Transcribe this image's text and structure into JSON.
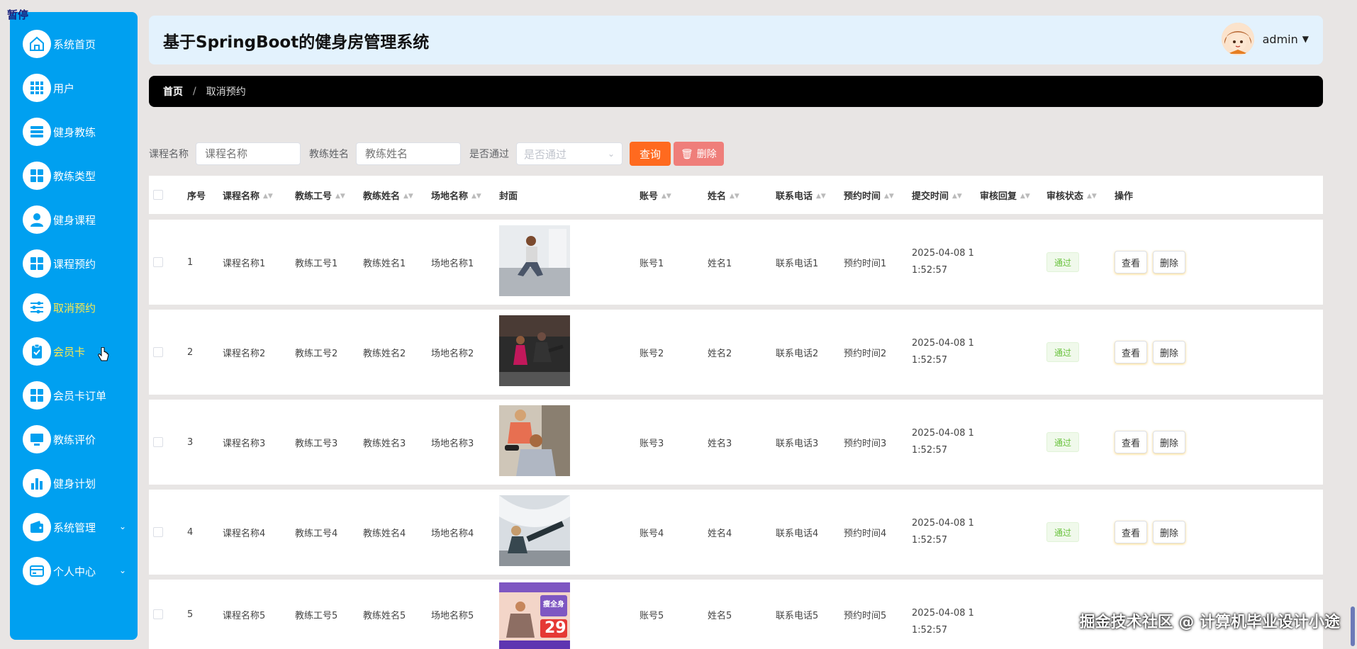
{
  "overlay": {
    "pause": "暂停",
    "watermark": "掘金技术社区 @ 计算机毕业设计小途"
  },
  "header": {
    "title": "基于SpringBoot的健身房管理系统",
    "user": "admin"
  },
  "breadcrumb": {
    "home": "首页",
    "current": "取消预约"
  },
  "sidebar": {
    "items": [
      {
        "label": "系统首页",
        "icon": "home-icon"
      },
      {
        "label": "用户",
        "icon": "grid-icon"
      },
      {
        "label": "健身教练",
        "icon": "list-icon"
      },
      {
        "label": "教练类型",
        "icon": "apps-icon"
      },
      {
        "label": "健身课程",
        "icon": "user-icon"
      },
      {
        "label": "课程预约",
        "icon": "apps-icon"
      },
      {
        "label": "取消预约",
        "icon": "sliders-icon"
      },
      {
        "label": "会员卡",
        "icon": "clipboard-check-icon"
      },
      {
        "label": "会员卡订单",
        "icon": "apps-icon"
      },
      {
        "label": "教练评价",
        "icon": "monitor-icon"
      },
      {
        "label": "健身计划",
        "icon": "bar-chart-icon"
      },
      {
        "label": "系统管理",
        "icon": "wallet-icon"
      },
      {
        "label": "个人中心",
        "icon": "card-icon"
      }
    ]
  },
  "search": {
    "course_label": "课程名称",
    "course_placeholder": "课程名称",
    "coach_label": "教练姓名",
    "coach_placeholder": "教练姓名",
    "pass_label": "是否通过",
    "pass_placeholder": "是否通过",
    "query_button": "查询",
    "delete_button": "删除"
  },
  "table": {
    "columns": [
      "序号",
      "课程名称",
      "教练工号",
      "教练姓名",
      "场地名称",
      "封面",
      "账号",
      "姓名",
      "联系电话",
      "预约时间",
      "提交时间",
      "审核回复",
      "审核状态",
      "操作"
    ],
    "rows": [
      {
        "no": "1",
        "course": "课程名称1",
        "coach_id": "教练工号1",
        "coach": "教练姓名1",
        "venue": "场地名称1",
        "account": "账号1",
        "name": "姓名1",
        "phone": "联系电话1",
        "reserve": "预约时间1",
        "submit1": "2025-04-08 1",
        "submit2": "1:52:57",
        "status": "通过",
        "view": "查看",
        "del": "删除"
      },
      {
        "no": "2",
        "course": "课程名称2",
        "coach_id": "教练工号2",
        "coach": "教练姓名2",
        "venue": "场地名称2",
        "account": "账号2",
        "name": "姓名2",
        "phone": "联系电话2",
        "reserve": "预约时间2",
        "submit1": "2025-04-08 1",
        "submit2": "1:52:57",
        "status": "通过",
        "view": "查看",
        "del": "删除"
      },
      {
        "no": "3",
        "course": "课程名称3",
        "coach_id": "教练工号3",
        "coach": "教练姓名3",
        "venue": "场地名称3",
        "account": "账号3",
        "name": "姓名3",
        "phone": "联系电话3",
        "reserve": "预约时间3",
        "submit1": "2025-04-08 1",
        "submit2": "1:52:57",
        "status": "通过",
        "view": "查看",
        "del": "删除"
      },
      {
        "no": "4",
        "course": "课程名称4",
        "coach_id": "教练工号4",
        "coach": "教练姓名4",
        "venue": "场地名称4",
        "account": "账号4",
        "name": "姓名4",
        "phone": "联系电话4",
        "reserve": "预约时间4",
        "submit1": "2025-04-08 1",
        "submit2": "1:52:57",
        "status": "通过",
        "view": "查看",
        "del": "删除"
      },
      {
        "no": "5",
        "course": "课程名称5",
        "coach_id": "教练工号5",
        "coach": "教练姓名5",
        "venue": "场地名称5",
        "account": "账号5",
        "name": "姓名5",
        "phone": "联系电话5",
        "reserve": "预约时间5",
        "submit1": "2025-04-08 1",
        "submit2": "1:52:57"
      }
    ],
    "poster_text": {
      "badge": "瘦全身",
      "price": "29"
    }
  }
}
